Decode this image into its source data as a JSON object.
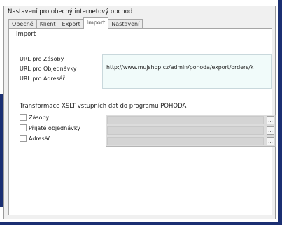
{
  "window": {
    "title": "Nastavení pro obecný internetový obchod"
  },
  "tabs": [
    {
      "label": "Obecné"
    },
    {
      "label": "Klient"
    },
    {
      "label": "Export"
    },
    {
      "label": "Import"
    },
    {
      "label": "Nastavení"
    }
  ],
  "import": {
    "group_label": "Import",
    "url_labels": [
      "URL pro Zásoby",
      "URL pro Objednávky",
      "URL pro Adresář"
    ],
    "url_value": "http://www.mujshop.cz/admin/pohoda/export/orders/k"
  },
  "xslt": {
    "group_label": "Transformace XSLT vstupních dat do programu POHODA",
    "items": [
      {
        "label": "Zásoby"
      },
      {
        "label": "Přijaté objednávky"
      },
      {
        "label": "Adresář"
      }
    ],
    "browse_label": "..."
  }
}
